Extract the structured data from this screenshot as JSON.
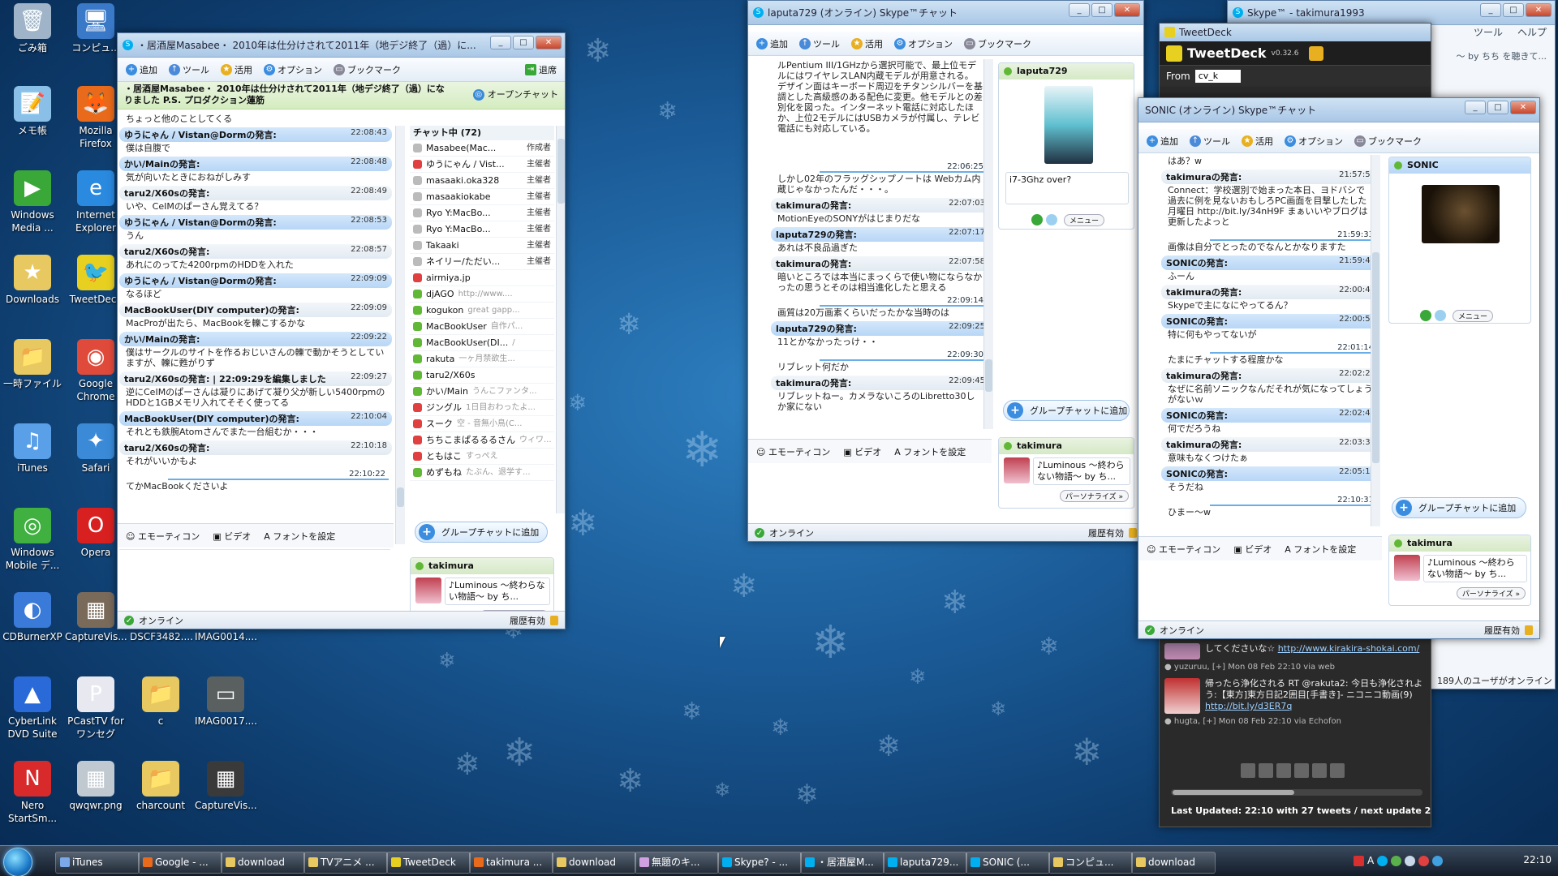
{
  "desktop": {
    "icons": [
      {
        "label": "ごみ箱",
        "icon": "recycle-bin-icon",
        "color": "#9fb4c8",
        "glyph": "🗑"
      },
      {
        "label": "コンピュ...",
        "icon": "computer-icon",
        "color": "#3a78c8",
        "glyph": "🖥"
      },
      {
        "label": "メモ帳",
        "icon": "notepad-icon",
        "color": "#8ac0e8",
        "glyph": "📝"
      },
      {
        "label": "Mozilla Firefox",
        "icon": "firefox-icon",
        "color": "#e86a1a",
        "glyph": "🦊"
      },
      {
        "label": "Windows Media ...",
        "icon": "media-player-icon",
        "color": "#3aa838",
        "glyph": "▶"
      },
      {
        "label": "Internet Explorer",
        "icon": "ie-icon",
        "color": "#2a8ae0",
        "glyph": "e"
      },
      {
        "label": "Downloads",
        "icon": "downloads-folder-icon",
        "color": "#e8c860",
        "glyph": "★"
      },
      {
        "label": "TweetDeck",
        "icon": "tweetdeck-icon",
        "color": "#e8d020",
        "glyph": "🐦"
      },
      {
        "label": "一時ファイル",
        "icon": "folder-icon",
        "color": "#e8c860",
        "glyph": "📁"
      },
      {
        "label": "Google Chrome",
        "icon": "chrome-icon",
        "color": "#e04a3a",
        "glyph": "◉"
      },
      {
        "label": "iTunes",
        "icon": "itunes-icon",
        "color": "#5aa0e8",
        "glyph": "♫"
      },
      {
        "label": "Safari",
        "icon": "safari-icon",
        "color": "#3a8ad8",
        "glyph": "✦"
      },
      {
        "label": "Windows Mobile デ...",
        "icon": "windows-mobile-icon",
        "color": "#40b040",
        "glyph": "◎"
      },
      {
        "label": "Opera",
        "icon": "opera-icon",
        "color": "#d82020",
        "glyph": "O"
      },
      {
        "label": "CDBurnerXP",
        "icon": "cdburner-icon",
        "color": "#3a7ad8",
        "glyph": "◐"
      },
      {
        "label": "CaptureVis...",
        "icon": "image-file-icon",
        "color": "#7a6a5a",
        "glyph": "▦"
      },
      {
        "label": "DSCF3482....",
        "icon": "image-file-icon",
        "color": "#6a7a8a",
        "glyph": ""
      },
      {
        "label": "IMAG0014....",
        "icon": "image-file-icon",
        "color": "#5a6a7a",
        "glyph": ""
      },
      {
        "label": "CyberLink DVD Suite",
        "icon": "cyberlink-icon",
        "color": "#2a6ad8",
        "glyph": "▲"
      },
      {
        "label": "PCastTV for ワンセグ",
        "icon": "pcast-icon",
        "color": "#e8e8f0",
        "glyph": "P"
      },
      {
        "label": "c",
        "icon": "folder-icon",
        "color": "#e8c860",
        "glyph": "📁"
      },
      {
        "label": "IMAG0017....",
        "icon": "image-file-icon",
        "color": "#5a6060",
        "glyph": "▭"
      },
      {
        "label": "Nero StartSm...",
        "icon": "nero-icon",
        "color": "#d82a2a",
        "glyph": "N"
      },
      {
        "label": "qwqwr.png",
        "icon": "image-file-icon",
        "color": "#c0c8d0",
        "glyph": "▦"
      },
      {
        "label": "charcount",
        "icon": "folder-icon",
        "color": "#e8c860",
        "glyph": "📁"
      },
      {
        "label": "CaptureVis...",
        "icon": "image-file-icon",
        "color": "#3a3a3a",
        "glyph": "▦"
      }
    ]
  },
  "common": {
    "add": "追加",
    "tools": "ツール",
    "use": "活用",
    "options": "オプション",
    "bookmark": "ブックマーク",
    "emoticon": "エモーティコン",
    "video": "ビデオ",
    "font": "フォントを設定",
    "online": "オンライン",
    "history": "履歴有効",
    "addgroup": "グループチャットに追加",
    "menu": "メニュー",
    "me_name": "takimura",
    "me_mood": "♪Luminous ～終わらない物語～ by ち...",
    "personalize": "パーソナライズ »",
    "role_owner": "主催者",
    "role_creator": "作成者"
  },
  "win1": {
    "title": "・居酒屋Masabee・ 2010年は仕分けされて2011年（地デジ終了（過）に...",
    "leave": "退席",
    "topic": "・居酒屋Masabee・ 2010年は仕分けされて2011年（地デジ終了（過）になりました P.S. プロダクション蓮筋",
    "open": "オープンチャット",
    "first_line": "ちょっと他のことしてくる",
    "messages": [
      {
        "who": "ゆうにゃん / Vistan@Dormの発言:",
        "t": "22:08:43",
        "me": true,
        "body": "僕は自腹で"
      },
      {
        "who": "かい/Mainの発言:",
        "t": "22:08:48",
        "me": true,
        "body": "気が向いたときにおねがしみす"
      },
      {
        "who": "taru2/X60sの発言:",
        "t": "22:08:49",
        "me": false,
        "body": "いや、CeIMのぱーさん覚えてる？"
      },
      {
        "who": "ゆうにゃん / Vistan@Dormの発言:",
        "t": "22:08:53",
        "me": true,
        "body": "うん"
      },
      {
        "who": "taru2/X60sの発言:",
        "t": "22:08:57",
        "me": false,
        "body": "あれにのってた4200rpmのHDDを入れた"
      },
      {
        "who": "ゆうにゃん / Vistan@Dormの発言:",
        "t": "22:09:09",
        "me": true,
        "body": "なるほど"
      },
      {
        "who": "MacBookUser(DIY computer)の発言:",
        "t": "22:09:09",
        "me": false,
        "body": "MacProが出たら、MacBookを轢こするかな"
      },
      {
        "who": "かい/Mainの発言:",
        "t": "22:09:22",
        "me": true,
        "body": "僕はサークルのサイトを作るおじいさんの轢で動かそうとしていますが、轢に甦がりず"
      },
      {
        "who": "taru2/X60sの発言: | 22:09:29を編集しました",
        "t": "22:09:27",
        "me": false,
        "body": "逆にCeIMのぱーさんは凝りにあげて凝り父が新しい5400rpmのHDDと1GBメモリ入れてそそく使ってる"
      },
      {
        "who": "MacBookUser(DIY computer)の発言:",
        "t": "22:10:04",
        "me": true,
        "body": "それとも鉄腕Atomさんでまた一台組むか・・・"
      },
      {
        "who": "taru2/X60sの発言:",
        "t": "22:10:18",
        "me": false,
        "body": "それがいいかもよ"
      }
    ],
    "last_time": "22:10:22",
    "last_line": "てかMacBookくださいよ",
    "members_header": "チャット中 (72)",
    "members": [
      {
        "name": "Masabee(Mac...",
        "mood": "",
        "role": "作成者",
        "s": "aw"
      },
      {
        "name": "ゆうにゃん / Vist...",
        "mood": "",
        "role": "主催者",
        "s": "bz"
      },
      {
        "name": "masaaki.oka328",
        "mood": "",
        "role": "主催者",
        "s": "aw"
      },
      {
        "name": "masaakiokabe",
        "mood": "",
        "role": "主催者",
        "s": "aw"
      },
      {
        "name": "Ryo Y:MacBo...",
        "mood": "",
        "role": "主催者",
        "s": "aw"
      },
      {
        "name": "Ryo Y:MacBo...",
        "mood": "",
        "role": "主催者",
        "s": "aw"
      },
      {
        "name": "Takaaki",
        "mood": "",
        "role": "主催者",
        "s": "aw"
      },
      {
        "name": "ネイリー/ただい...",
        "mood": "",
        "role": "主催者",
        "s": "aw"
      },
      {
        "name": "airmiya.jp",
        "mood": "",
        "role": "",
        "s": "bz"
      },
      {
        "name": "djAGO",
        "mood": "http://www....",
        "role": "",
        "s": "on"
      },
      {
        "name": "kogukon",
        "mood": "great gapp...",
        "role": "",
        "s": "on"
      },
      {
        "name": "MacBookUser",
        "mood": "自作パ...",
        "role": "",
        "s": "on"
      },
      {
        "name": "MacBookUser(DI...",
        "mood": "/",
        "role": "",
        "s": "on"
      },
      {
        "name": "rakuta",
        "mood": "一ヶ月禁欲生...",
        "role": "",
        "s": "on"
      },
      {
        "name": "taru2/X60s",
        "mood": "",
        "role": "",
        "s": "on"
      },
      {
        "name": "かい/Main",
        "mood": "うんこファンタ...",
        "role": "",
        "s": "on"
      },
      {
        "name": "ジングル",
        "mood": "1日目おわったよ...",
        "role": "",
        "s": "bz"
      },
      {
        "name": "スーク",
        "mood": "空 - 音無小鳥(C...",
        "role": "",
        "s": "bz"
      },
      {
        "name": "ちちこまぱるるるさん",
        "mood": "ウィワ...",
        "role": "",
        "s": "bz"
      },
      {
        "name": "ともはこ",
        "mood": "すっぺえ",
        "role": "",
        "s": "bz"
      },
      {
        "name": "めずもね",
        "mood": "たぶん、退学す...",
        "role": "",
        "s": "on"
      }
    ]
  },
  "win2": {
    "title": "laputa729 (オンライン) Skype™チャット",
    "intro": "ルPentium III/1GHzから選択可能で、最上位モデルにはワイヤレスLAN内蔵モデルが用意される。　デザイン面はキーボード周辺をチタンシルバーを基調とした高級感のある配色に変更。他モデルとの差別化を図った。インターネット電話に対応したほか、上位2モデルにはUSBカメラが付属し、テレビ電話にも対応している。",
    "messages": [
      {
        "who": "",
        "t": "22:06:25",
        "me": false,
        "body": "しかし02年のフラッグシップノートは Webカム内蔵じゃなかったんだ・・・。",
        "line": true
      },
      {
        "who": "takimuraの発言:",
        "t": "22:07:03",
        "me": false,
        "body": "MotionEyeのSONYがはじまりだな"
      },
      {
        "who": "laputa729の発言:",
        "t": "22:07:17",
        "me": true,
        "body": "あれは不良品過ぎた"
      },
      {
        "who": "takimuraの発言:",
        "t": "22:07:58",
        "me": false,
        "body": "暗いところでは本当にまっくらで使い物にならなかったの思うとそのは相当進化したと思える"
      },
      {
        "who": "",
        "t": "22:09:14",
        "me": false,
        "body": "画質は20万画素くらいだったかな当時のは",
        "line": true
      },
      {
        "who": "laputa729の発言:",
        "t": "22:09:25",
        "me": true,
        "body": "11とかなかったっけ・・"
      },
      {
        "who": "",
        "t": "22:09:30",
        "me": false,
        "body": "リブレット何だか",
        "line": true
      },
      {
        "who": "takimuraの発言:",
        "t": "22:09:45",
        "me": false,
        "body": "リブレットねー。カメラないころのLibretto30しか家にない"
      }
    ],
    "contact_name": "laputa729",
    "contact_mood": "i7-3Ghz over?"
  },
  "win3": {
    "title": "SONIC (オンライン) Skype™チャット",
    "first_line": "はあ？w",
    "messages": [
      {
        "who": "takimuraの発言:",
        "t": "21:57:54",
        "me": false,
        "body": "Connect：学校選別で始まった本日、ヨドバシで過去に例を見ないおもしろPC画面を目撃したした月曜日 http://bit.ly/34nH9F まぁいいやブログは更新したよっと"
      },
      {
        "who": "",
        "t": "21:59:33",
        "me": false,
        "body": "画像は自分でとったのでなんとかなりますた",
        "line": true
      },
      {
        "who": "SONICの発言:",
        "t": "21:59:45",
        "me": true,
        "body": "ふーん"
      },
      {
        "who": "takimuraの発言:",
        "t": "22:00:41",
        "me": false,
        "body": "Skypeで主になにやってるん？"
      },
      {
        "who": "SONICの発言:",
        "t": "22:00:57",
        "me": true,
        "body": "特に何もやってないが"
      },
      {
        "who": "",
        "t": "22:01:14",
        "me": false,
        "body": "たまにチャットする程度かな",
        "line": true
      },
      {
        "who": "takimuraの発言:",
        "t": "22:02:25",
        "me": false,
        "body": "なぜに名前ソニックなんだそれが気になってしょうがないｗ"
      },
      {
        "who": "SONICの発言:",
        "t": "22:02:44",
        "me": true,
        "body": "何でだろうね"
      },
      {
        "who": "takimuraの発言:",
        "t": "22:03:35",
        "me": false,
        "body": "意味もなくつけたぁ"
      },
      {
        "who": "SONICの発言:",
        "t": "22:05:13",
        "me": true,
        "body": "そうだね"
      },
      {
        "who": "",
        "t": "22:10:31",
        "me": false,
        "body": "ひまー～w",
        "line": true
      }
    ],
    "contact_name": "SONIC"
  },
  "tweetdeck": {
    "title": "TweetDeck",
    "brand": "TweetDeck",
    "version": "v0.32.6",
    "from_label": "From",
    "from_value": "cv_k",
    "tweet1_text": "してくださいな☆",
    "tweet1_link": "http://www.kirakira-shokai.com/",
    "tweet1_meta": "● yuzuruu, [+] Mon 08 Feb 22:10 via web",
    "tweet2_text": "帰ったら浄化される RT @rakuta2: 今日も浄化されよう:【東方]東方日記2囲目[手書き]- ニコニコ動画(9)",
    "tweet2_link": "http://bit.ly/d3ER7q",
    "tweet2_meta": "● hugta, [+] Mon 08 Feb 22:10 via Echofon",
    "footer": "Last Updated: 22:10 with 27 tweets / next update 22:10"
  },
  "skype_main": {
    "title": "Skype™ - takimura1993",
    "menu_tools": "ツール",
    "menu_help": "ヘルプ",
    "mood_hint": "～ by ちち を聴きて...",
    "online_users": "189人のユーザがオンライン"
  },
  "taskbar": {
    "items": [
      {
        "label": "iTunes",
        "c": "#7aa8e8"
      },
      {
        "label": "Google - ...",
        "c": "#e86a1a"
      },
      {
        "label": "download",
        "c": "#e8c860"
      },
      {
        "label": "TVアニメ ...",
        "c": "#e8c860"
      },
      {
        "label": "TweetDeck",
        "c": "#e8d020"
      },
      {
        "label": "takimura ...",
        "c": "#e86a1a"
      },
      {
        "label": "download",
        "c": "#e8c860"
      },
      {
        "label": "無題のキ...",
        "c": "#d0a0e0"
      },
      {
        "label": "Skype? - ...",
        "c": "#00aff0"
      },
      {
        "label": "・居酒屋M...",
        "c": "#00aff0"
      },
      {
        "label": "laputa729...",
        "c": "#00aff0"
      },
      {
        "label": "SONIC (...",
        "c": "#00aff0"
      },
      {
        "label": "コンピュ...",
        "c": "#e8c860"
      },
      {
        "label": "download",
        "c": "#e8c860"
      }
    ],
    "ime": "A",
    "clock": "22:10"
  }
}
